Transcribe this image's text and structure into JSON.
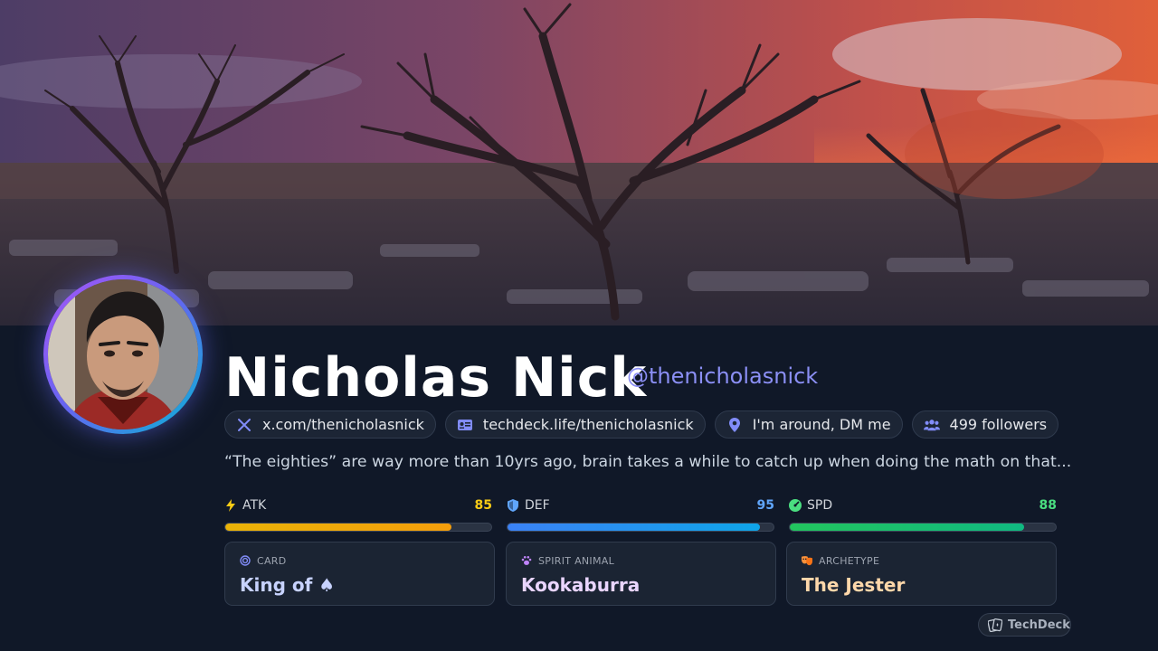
{
  "profile": {
    "name": "Nicholas Nick",
    "handle": "@thenicholasnick",
    "bio": "“The eighties” are way more than 10yrs ago, brain takes a while to catch up when doing the math on that..."
  },
  "chips": [
    {
      "icon": "x-logo-icon",
      "label": "x.com/thenicholasnick"
    },
    {
      "icon": "id-card-icon",
      "label": "techdeck.life/thenicholasnick"
    },
    {
      "icon": "location-pin-icon",
      "label": "I'm around, DM me"
    },
    {
      "icon": "users-icon",
      "label": "499 followers"
    }
  ],
  "stats": [
    {
      "label": "ATK",
      "value": 85,
      "icon": "bolt-icon",
      "color": "#facc15"
    },
    {
      "label": "DEF",
      "value": 95,
      "icon": "shield-icon",
      "color": "#60a5fa"
    },
    {
      "label": "SPD",
      "value": 88,
      "icon": "speedometer-icon",
      "color": "#4ade80"
    }
  ],
  "cards": [
    {
      "label": "CARD",
      "value": "King of ♠",
      "icon": "target-icon",
      "color": "#c7d2fe"
    },
    {
      "label": "SPIRIT ANIMAL",
      "value": "Kookaburra",
      "icon": "paw-icon",
      "color": "#e9d5ff"
    },
    {
      "label": "ARCHETYPE",
      "value": "The Jester",
      "icon": "masks-icon",
      "color": "#fed7aa"
    }
  ],
  "brand": {
    "label": "TechDeck"
  },
  "colors": {
    "accent": "#818cf8",
    "background": "#101828"
  }
}
